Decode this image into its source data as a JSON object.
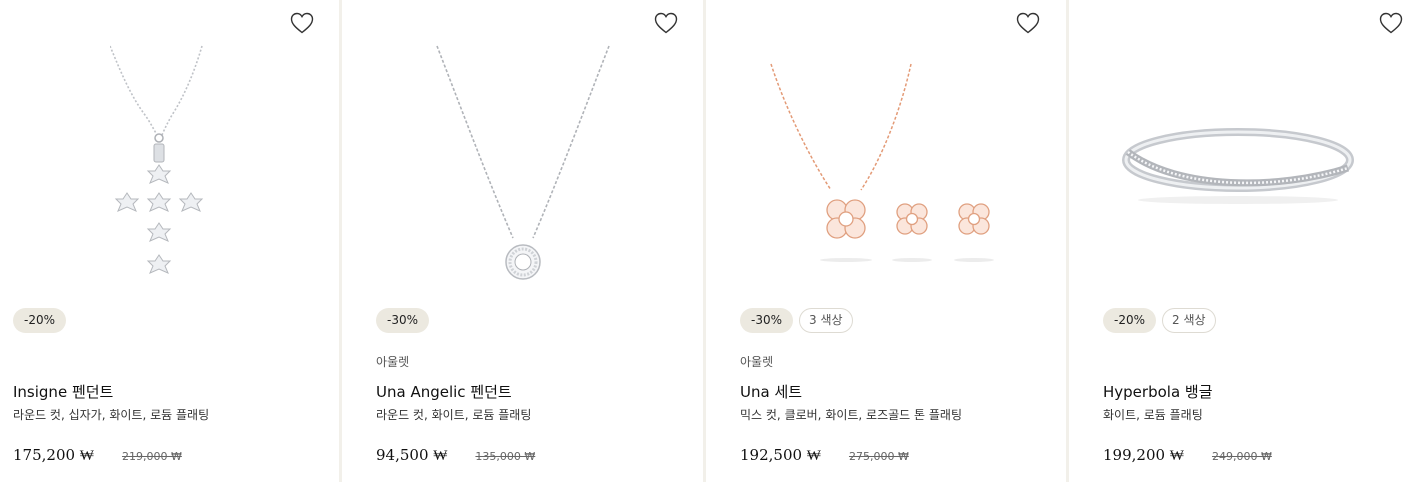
{
  "products": [
    {
      "name": "Insigne 펜던트",
      "tag": "",
      "description": "라운드 컷, 십자가, 화이트, 로듐 플래팅",
      "price": "175,200 ₩",
      "original_price": "219,000 ₩",
      "discount": "-20%",
      "colors": "",
      "image_icon": "cross-pendant-image"
    },
    {
      "name": "Una Angelic 펜던트",
      "tag": "아울렛",
      "description": "라운드 컷, 화이트, 로듐 플래팅",
      "price": "94,500 ₩",
      "original_price": "135,000 ₩",
      "discount": "-30%",
      "colors": "",
      "image_icon": "solitaire-pendant-image"
    },
    {
      "name": "Una 세트",
      "tag": "아울렛",
      "description": "믹스 컷, 클로버, 화이트, 로즈골드 톤 플래팅",
      "price": "192,500 ₩",
      "original_price": "275,000 ₩",
      "discount": "-30%",
      "colors": "3 색상",
      "image_icon": "clover-set-image"
    },
    {
      "name": "Hyperbola 뱅글",
      "tag": "",
      "description": "화이트, 로듐 플래팅",
      "price": "199,200 ₩",
      "original_price": "249,000 ₩",
      "discount": "-20%",
      "colors": "2 색상",
      "image_icon": "bangle-image"
    }
  ],
  "icons": {
    "wishlist": "heart-outline-icon"
  },
  "colors": {
    "background": "#f2f0ea",
    "badge": "#ece9e0",
    "silver": "#b9bcc1",
    "rose_gold": "#e9a07c"
  }
}
